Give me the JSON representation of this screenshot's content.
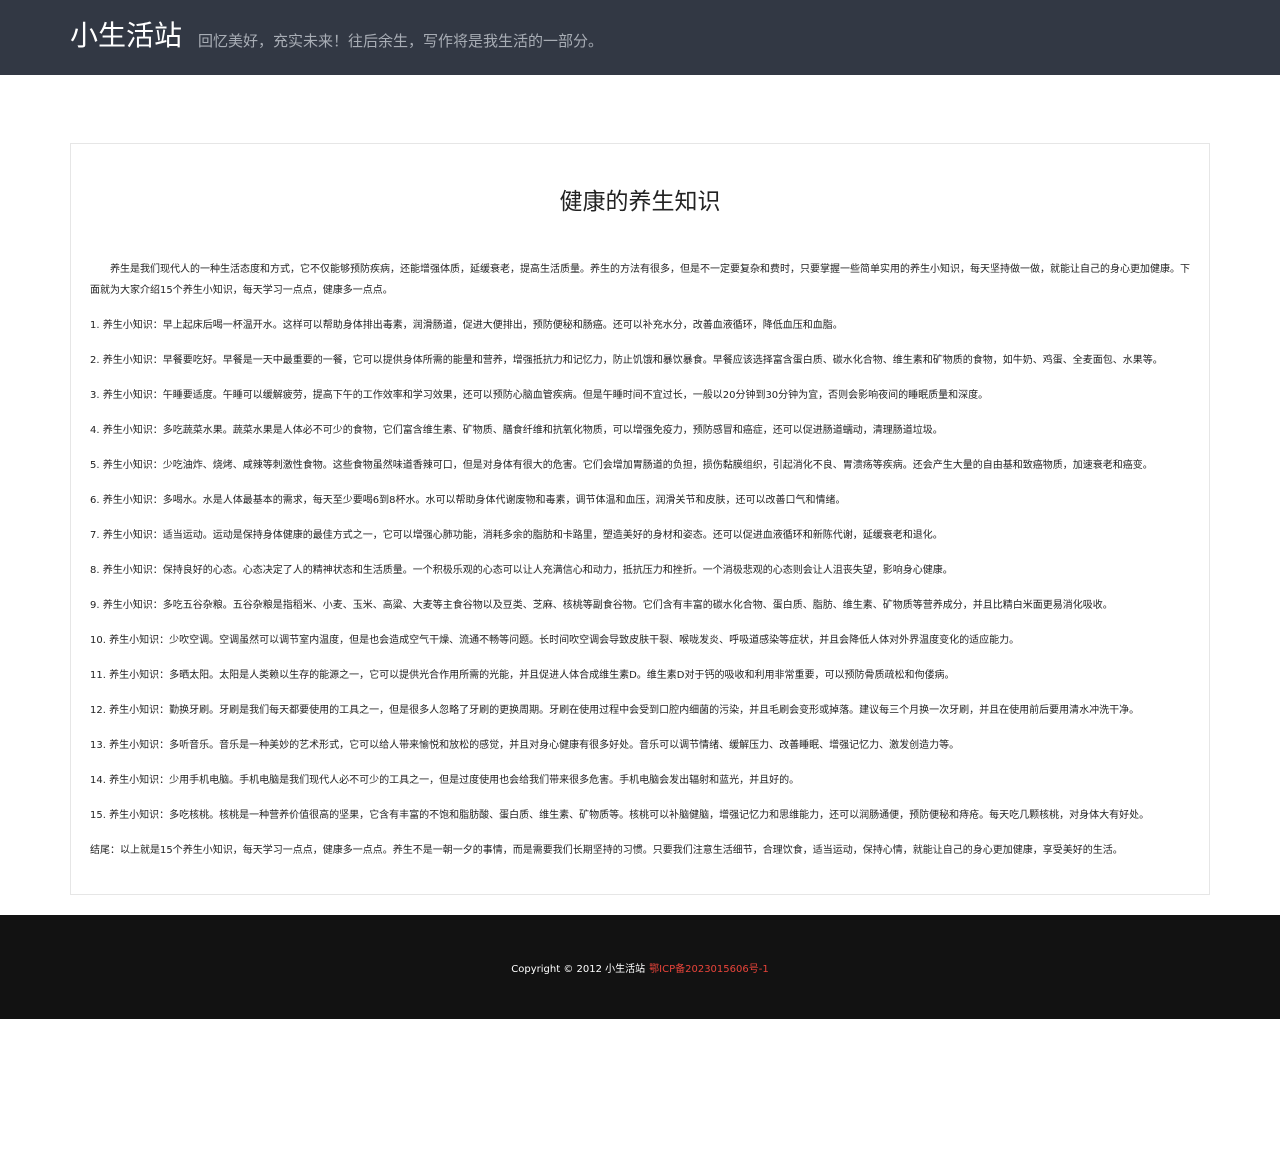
{
  "header": {
    "site_title": "小生活站",
    "tagline": "回忆美好，充实未来！往后余生，写作将是我生活的一部分。"
  },
  "article": {
    "title": "健康的养生知识",
    "intro": "养生是我们现代人的一种生活态度和方式，它不仅能够预防疾病，还能增强体质，延缓衰老，提高生活质量。养生的方法有很多，但是不一定要复杂和费时，只要掌握一些简单实用的养生小知识，每天坚持做一做，就能让自己的身心更加健康。下面就为大家介绍15个养生小知识，每天学习一点点，健康多一点点。",
    "tips": [
      "1. 养生小知识：早上起床后喝一杯温开水。这样可以帮助身体排出毒素，润滑肠道，促进大便排出，预防便秘和肠癌。还可以补充水分，改善血液循环，降低血压和血脂。",
      "2. 养生小知识：早餐要吃好。早餐是一天中最重要的一餐，它可以提供身体所需的能量和营养，增强抵抗力和记忆力，防止饥饿和暴饮暴食。早餐应该选择富含蛋白质、碳水化合物、维生素和矿物质的食物，如牛奶、鸡蛋、全麦面包、水果等。",
      "3. 养生小知识：午睡要适度。午睡可以缓解疲劳，提高下午的工作效率和学习效果，还可以预防心脑血管疾病。但是午睡时间不宜过长，一般以20分钟到30分钟为宜，否则会影响夜间的睡眠质量和深度。",
      "4. 养生小知识：多吃蔬菜水果。蔬菜水果是人体必不可少的食物，它们富含维生素、矿物质、膳食纤维和抗氧化物质，可以增强免疫力，预防感冒和癌症，还可以促进肠道蠕动，清理肠道垃圾。",
      "5. 养生小知识：少吃油炸、烧烤、咸辣等刺激性食物。这些食物虽然味道香辣可口，但是对身体有很大的危害。它们会增加胃肠道的负担，损伤黏膜组织，引起消化不良、胃溃疡等疾病。还会产生大量的自由基和致癌物质，加速衰老和癌变。",
      "6. 养生小知识：多喝水。水是人体最基本的需求，每天至少要喝6到8杯水。水可以帮助身体代谢废物和毒素，调节体温和血压，润滑关节和皮肤，还可以改善口气和情绪。",
      "7. 养生小知识：适当运动。运动是保持身体健康的最佳方式之一，它可以增强心肺功能，消耗多余的脂肪和卡路里，塑造美好的身材和姿态。还可以促进血液循环和新陈代谢，延缓衰老和退化。",
      "8. 养生小知识：保持良好的心态。心态决定了人的精神状态和生活质量。一个积极乐观的心态可以让人充满信心和动力，抵抗压力和挫折。一个消极悲观的心态则会让人沮丧失望，影响身心健康。",
      "9. 养生小知识：多吃五谷杂粮。五谷杂粮是指稻米、小麦、玉米、高粱、大麦等主食谷物以及豆类、芝麻、核桃等副食谷物。它们含有丰富的碳水化合物、蛋白质、脂肪、维生素、矿物质等营养成分，并且比精白米面更易消化吸收。",
      "10. 养生小知识：少吹空调。空调虽然可以调节室内温度，但是也会造成空气干燥、流通不畅等问题。长时间吹空调会导致皮肤干裂、喉咙发炎、呼吸道感染等症状，并且会降低人体对外界温度变化的适应能力。",
      "11. 养生小知识：多晒太阳。太阳是人类赖以生存的能源之一，它可以提供光合作用所需的光能，并且促进人体合成维生素D。维生素D对于钙的吸收和利用非常重要，可以预防骨质疏松和佝偻病。",
      "12. 养生小知识：勤换牙刷。牙刷是我们每天都要使用的工具之一，但是很多人忽略了牙刷的更换周期。牙刷在使用过程中会受到口腔内细菌的污染，并且毛刷会变形或掉落。建议每三个月换一次牙刷，并且在使用前后要用清水冲洗干净。",
      "13. 养生小知识：多听音乐。音乐是一种美妙的艺术形式，它可以给人带来愉悦和放松的感觉，并且对身心健康有很多好处。音乐可以调节情绪、缓解压力、改善睡眠、增强记忆力、激发创造力等。",
      "14. 养生小知识：少用手机电脑。手机电脑是我们现代人必不可少的工具之一，但是过度使用也会给我们带来很多危害。手机电脑会发出辐射和蓝光，并且好的。",
      "15. 养生小知识：多吃核桃。核桃是一种营养价值很高的坚果，它含有丰富的不饱和脂肪酸、蛋白质、维生素、矿物质等。核桃可以补脑健脑，增强记忆力和思维能力，还可以润肠通便，预防便秘和痔疮。每天吃几颗核桃，对身体大有好处。"
    ],
    "conclusion": "结尾：以上就是15个养生小知识，每天学习一点点，健康多一点点。养生不是一朝一夕的事情，而是需要我们长期坚持的习惯。只要我们注意生活细节，合理饮食，适当运动，保持心情，就能让自己的身心更加健康，享受美好的生活。"
  },
  "footer": {
    "copyright": "Copyright © 2012 小生活站",
    "icp": "鄂ICP备2023015606号-1",
    "icp_color": "#e8443a"
  }
}
